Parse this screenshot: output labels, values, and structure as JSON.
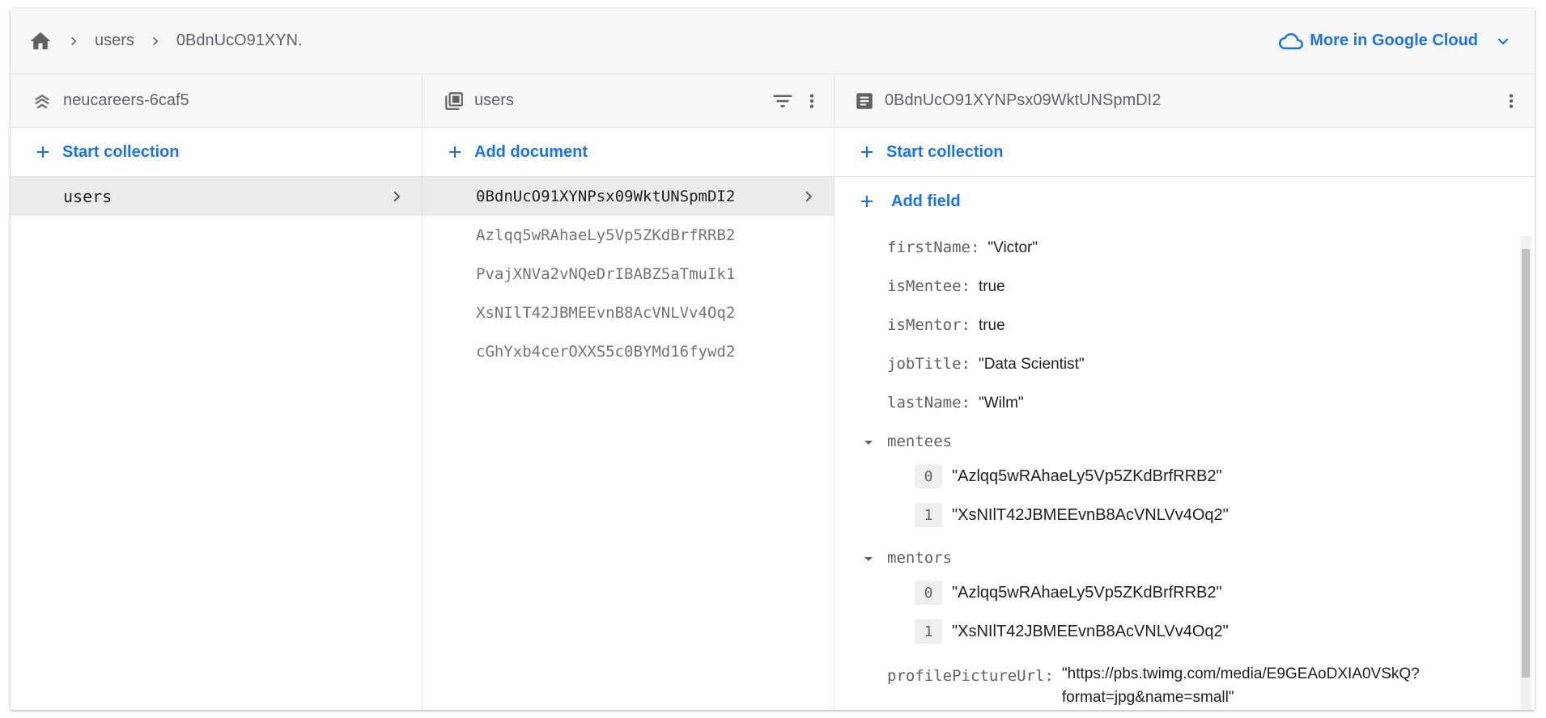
{
  "breadcrumb": {
    "items": [
      "users",
      "0BdnUcO91XYN."
    ],
    "cloud_label": "More in Google Cloud"
  },
  "columns": {
    "root": {
      "title": "neucareers-6caf5",
      "action": "Start collection",
      "items": [
        "users"
      ]
    },
    "collection": {
      "title": "users",
      "action": "Add document",
      "items": [
        "0BdnUcO91XYNPsx09WktUNSpmDI2",
        "Azlqq5wRAhaeLy5Vp5ZKdBrfRRB2",
        "PvajXNVa2vNQeDrIBABZ5aTmuIk1",
        "XsNIlT42JBMEEvnB8AcVNLVv4Oq2",
        "cGhYxb4cerOXXS5c0BYMd16fywd2"
      ]
    },
    "document": {
      "title": "0BdnUcO91XYNPsx09WktUNSpmDI2",
      "action_collection": "Start collection",
      "action_field": "Add field",
      "fields": {
        "firstName": {
          "key": "firstName:",
          "value": "\"Victor\""
        },
        "isMentee": {
          "key": "isMentee:",
          "value": "true"
        },
        "isMentor": {
          "key": "isMentor:",
          "value": "true"
        },
        "jobTitle": {
          "key": "jobTitle:",
          "value": "\"Data Scientist\""
        },
        "lastName": {
          "key": "lastName:",
          "value": "\"Wilm\""
        },
        "mentees": {
          "key": "mentees",
          "items": [
            {
              "index": "0",
              "value": "\"Azlqq5wRAhaeLy5Vp5ZKdBrfRRB2\""
            },
            {
              "index": "1",
              "value": "\"XsNIlT42JBMEEvnB8AcVNLVv4Oq2\""
            }
          ]
        },
        "mentors": {
          "key": "mentors",
          "items": [
            {
              "index": "0",
              "value": "\"Azlqq5wRAhaeLy5Vp5ZKdBrfRRB2\""
            },
            {
              "index": "1",
              "value": "\"XsNIlT42JBMEEvnB8AcVNLVv4Oq2\""
            }
          ]
        },
        "profilePictureUrl": {
          "key": "profilePictureUrl:",
          "value_line1": "\"https://pbs.twimg.com/media/E9GEAoDXIA0VSkQ?",
          "value_line2": "format=jpg&name=small\""
        }
      }
    }
  },
  "icons": [
    "home-icon",
    "chevron-right-icon",
    "cloud-icon",
    "chevron-down-icon",
    "database-icon",
    "collection-icon",
    "filter-icon",
    "more-vert-icon",
    "document-icon",
    "plus-icon",
    "arrow-drop-down-icon"
  ],
  "colors": {
    "accent": "#1a73e8",
    "header_bg": "#f8f8f8",
    "selected_row": "#ebebeb"
  }
}
